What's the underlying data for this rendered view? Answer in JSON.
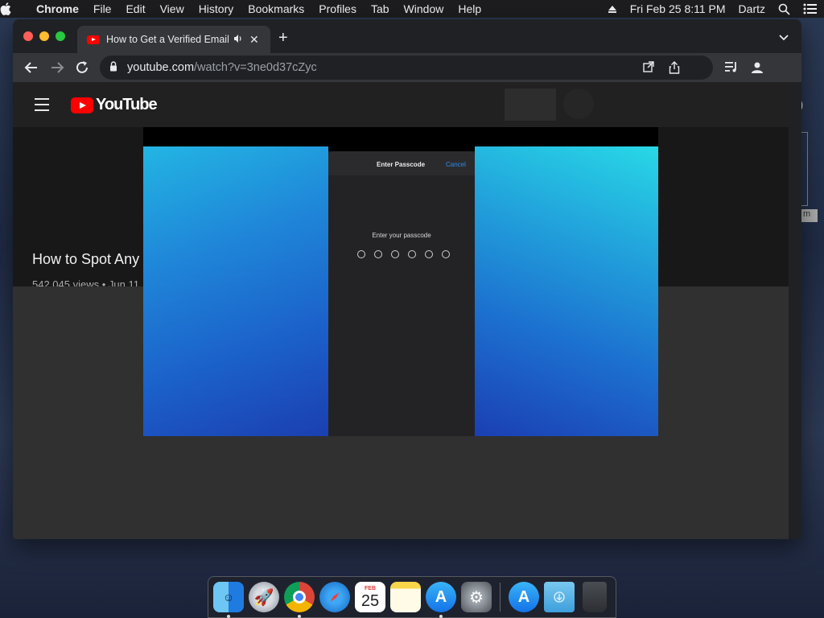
{
  "menubar": {
    "app_name": "Chrome",
    "items": [
      "File",
      "Edit",
      "View",
      "History",
      "Bookmarks",
      "Profiles",
      "Tab",
      "Window",
      "Help"
    ],
    "datetime": "Fri Feb 25  8:11 PM",
    "user": "Dartz"
  },
  "browser": {
    "tab_title": "How to Get a Verified Email",
    "address_host": "youtube.com",
    "address_path": "/watch?v=3ne0d37cZyc"
  },
  "youtube": {
    "logo_text": "YouTube",
    "video_title": "How to Spot Any",
    "video_meta": "542,045 views • Jun 11"
  },
  "video_frame": {
    "passcode_title": "Enter Passcode",
    "cancel_label": "Cancel",
    "prompt": "Enter your passcode",
    "digit_count": 6
  },
  "dock": {
    "calendar_month": "FEB",
    "calendar_day": "25",
    "apps": [
      "Finder",
      "Launchpad",
      "Google Chrome",
      "Safari",
      "Calendar",
      "Notes",
      "App Store",
      "System Preferences",
      "App Store",
      "Downloads",
      "Trash"
    ]
  },
  "desktop_peek": {
    "tag": "m"
  }
}
